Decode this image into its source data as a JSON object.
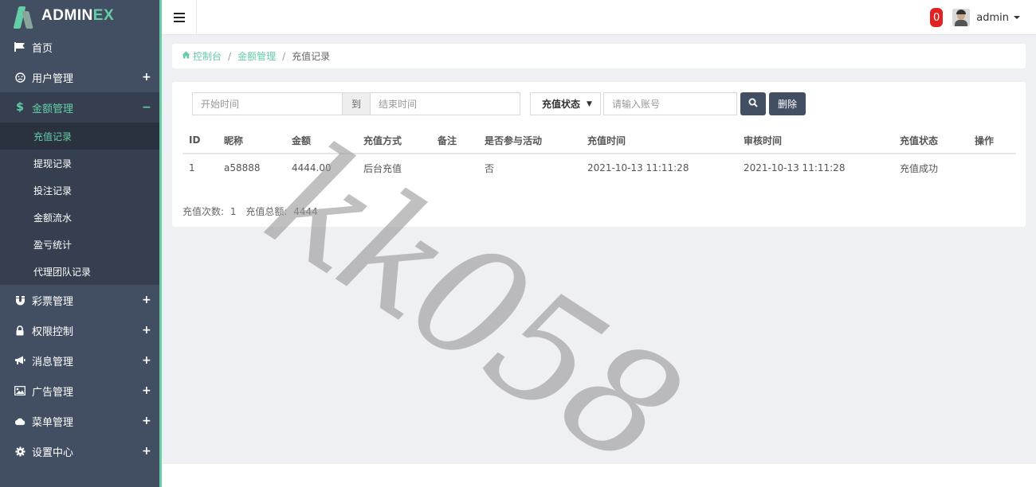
{
  "brand": {
    "prefix": "ADMIN",
    "suffix": "EX"
  },
  "sidebar": {
    "items": [
      {
        "label": "首页",
        "icon": "flag-icon",
        "toggle": ""
      },
      {
        "label": "用户管理",
        "icon": "user-face-icon",
        "toggle": "+"
      },
      {
        "label": "金额管理",
        "icon": "dollar-icon",
        "toggle": "−",
        "active": true
      },
      {
        "label": "彩票管理",
        "icon": "magnet-icon",
        "toggle": "+"
      },
      {
        "label": "权限控制",
        "icon": "lock-icon",
        "toggle": "+"
      },
      {
        "label": "消息管理",
        "icon": "bullhorn-icon",
        "toggle": "+"
      },
      {
        "label": "广告管理",
        "icon": "image-icon",
        "toggle": "+"
      },
      {
        "label": "菜单管理",
        "icon": "cloud-icon",
        "toggle": "+"
      },
      {
        "label": "设置中心",
        "icon": "gear-icon",
        "toggle": "+"
      }
    ],
    "submenu": [
      {
        "label": "充值记录",
        "active": true
      },
      {
        "label": "提现记录"
      },
      {
        "label": "投注记录"
      },
      {
        "label": "金额流水"
      },
      {
        "label": "盈亏统计"
      },
      {
        "label": "代理团队记录"
      }
    ]
  },
  "header": {
    "notification_count": "0",
    "user_name": "admin"
  },
  "breadcrumb": {
    "home": "控制台",
    "section": "金额管理",
    "current": "充值记录"
  },
  "filters": {
    "start_placeholder": "开始时间",
    "to_label": "到",
    "end_placeholder": "结束时间",
    "status_select": "充值状态",
    "account_placeholder": "请输入账号",
    "delete_label": "删除"
  },
  "table": {
    "headers": [
      "ID",
      "昵称",
      "金额",
      "充值方式",
      "备注",
      "是否参与活动",
      "充值时间",
      "审核时间",
      "充值状态",
      "操作"
    ],
    "rows": [
      [
        "1",
        "a58888",
        "4444.00",
        "后台充值",
        "",
        "否",
        "2021-10-13 11:11:28",
        "2021-10-13 11:11:28",
        "充值成功",
        ""
      ]
    ]
  },
  "summary": {
    "count_label": "充值次数:",
    "count_value": "1",
    "total_label": "充值总额:",
    "total_value": "4444"
  },
  "watermark": "kk058",
  "colors": {
    "sidebar_bg": "#424f63",
    "accent": "#65cea7",
    "badge_red": "#e02222"
  }
}
